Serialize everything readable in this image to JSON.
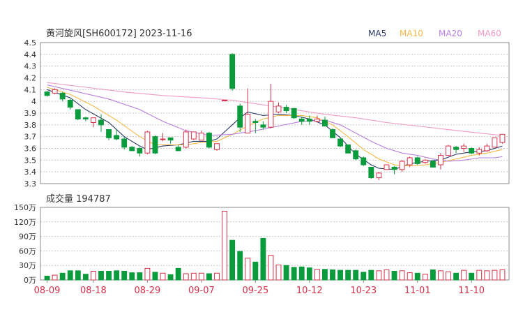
{
  "header": {
    "title": "黄河旋风[SH600172] 2023-11-16",
    "ma_legend": [
      {
        "label": "MA5",
        "color": "#2b3a67"
      },
      {
        "label": "MA10",
        "color": "#f5b94a"
      },
      {
        "label": "MA20",
        "color": "#b77fdf"
      },
      {
        "label": "MA60",
        "color": "#f09ac3"
      }
    ]
  },
  "colors": {
    "up": "#d6314a",
    "down": "#0a9b3c",
    "grid": "#c8c8c8",
    "axis": "#333333"
  },
  "chart_data": [
    {
      "type": "candlestick",
      "title": "黄河旋风[SH600172] 2023-11-16",
      "ylim": [
        3.3,
        4.5
      ],
      "yticks": [
        "3.3",
        "3.4",
        "3.5",
        "3.6",
        "3.7",
        "3.8",
        "3.9",
        "4",
        "4.1",
        "4.2",
        "4.3",
        "4.4",
        "4.5"
      ],
      "xtick_labels": [
        {
          "i": 0,
          "label": "08-09"
        },
        {
          "i": 6,
          "label": "08-18"
        },
        {
          "i": 13,
          "label": "08-29"
        },
        {
          "i": 20,
          "label": "09-07"
        },
        {
          "i": 27,
          "label": "09-25"
        },
        {
          "i": 34,
          "label": "10-12"
        },
        {
          "i": 41,
          "label": "10-23"
        },
        {
          "i": 48,
          "label": "11-01"
        },
        {
          "i": 55,
          "label": "11-10"
        }
      ],
      "candles": [
        {
          "o": 4.08,
          "c": 4.05,
          "h": 4.09,
          "l": 4.04
        },
        {
          "o": 4.07,
          "c": 4.1,
          "h": 4.11,
          "l": 4.06
        },
        {
          "o": 4.07,
          "c": 4.02,
          "h": 4.08,
          "l": 4.0
        },
        {
          "o": 4.01,
          "c": 3.95,
          "h": 4.02,
          "l": 3.93
        },
        {
          "o": 3.93,
          "c": 3.85,
          "h": 3.93,
          "l": 3.84
        },
        {
          "o": 3.86,
          "c": 3.85,
          "h": 3.87,
          "l": 3.83
        },
        {
          "o": 3.82,
          "c": 3.86,
          "h": 3.86,
          "l": 3.78
        },
        {
          "o": 3.84,
          "c": 3.8,
          "h": 3.89,
          "l": 3.74
        },
        {
          "o": 3.76,
          "c": 3.69,
          "h": 3.76,
          "l": 3.67
        },
        {
          "o": 3.71,
          "c": 3.68,
          "h": 3.76,
          "l": 3.67
        },
        {
          "o": 3.68,
          "c": 3.61,
          "h": 3.7,
          "l": 3.59
        },
        {
          "o": 3.61,
          "c": 3.58,
          "h": 3.62,
          "l": 3.58
        },
        {
          "o": 3.6,
          "c": 3.56,
          "h": 3.61,
          "l": 3.53
        },
        {
          "o": 3.56,
          "c": 3.74,
          "h": 3.75,
          "l": 3.55
        },
        {
          "o": 3.7,
          "c": 3.56,
          "h": 3.71,
          "l": 3.55
        },
        {
          "o": 3.68,
          "c": 3.68,
          "h": 3.73,
          "l": 3.66
        },
        {
          "o": 3.69,
          "c": 3.67,
          "h": 3.69,
          "l": 3.64
        },
        {
          "o": 3.61,
          "c": 3.58,
          "h": 3.63,
          "l": 3.58
        },
        {
          "o": 3.61,
          "c": 3.74,
          "h": 3.76,
          "l": 3.6
        },
        {
          "o": 3.68,
          "c": 3.74,
          "h": 3.74,
          "l": 3.67
        },
        {
          "o": 3.67,
          "c": 3.73,
          "h": 3.75,
          "l": 3.67
        },
        {
          "o": 3.73,
          "c": 3.61,
          "h": 3.74,
          "l": 3.6
        },
        {
          "o": 3.59,
          "c": 3.64,
          "h": 3.64,
          "l": 3.58
        },
        {
          "o": 4.01,
          "c": 4.01,
          "h": 4.01,
          "l": 4.01
        },
        {
          "o": 4.4,
          "c": 4.11,
          "h": 4.41,
          "l": 4.09
        },
        {
          "o": 3.96,
          "c": 3.78,
          "h": 3.98,
          "l": 3.74
        },
        {
          "o": 3.73,
          "c": 3.89,
          "h": 4.11,
          "l": 3.73
        },
        {
          "o": 3.83,
          "c": 3.82,
          "h": 3.85,
          "l": 3.73
        },
        {
          "o": 3.8,
          "c": 3.78,
          "h": 3.83,
          "l": 3.76
        },
        {
          "o": 3.78,
          "c": 4.0,
          "h": 4.15,
          "l": 3.77
        },
        {
          "o": 3.91,
          "c": 3.96,
          "h": 3.99,
          "l": 3.9
        },
        {
          "o": 3.95,
          "c": 3.92,
          "h": 3.97,
          "l": 3.9
        },
        {
          "o": 3.94,
          "c": 3.86,
          "h": 3.94,
          "l": 3.85
        },
        {
          "o": 3.85,
          "c": 3.83,
          "h": 3.87,
          "l": 3.8
        },
        {
          "o": 3.85,
          "c": 3.83,
          "h": 3.88,
          "l": 3.8
        },
        {
          "o": 3.83,
          "c": 3.85,
          "h": 3.88,
          "l": 3.82
        },
        {
          "o": 3.84,
          "c": 3.79,
          "h": 3.87,
          "l": 3.79
        },
        {
          "o": 3.76,
          "c": 3.69,
          "h": 3.77,
          "l": 3.69
        },
        {
          "o": 3.68,
          "c": 3.62,
          "h": 3.68,
          "l": 3.61
        },
        {
          "o": 3.63,
          "c": 3.56,
          "h": 3.63,
          "l": 3.56
        },
        {
          "o": 3.58,
          "c": 3.51,
          "h": 3.59,
          "l": 3.5
        },
        {
          "o": 3.52,
          "c": 3.46,
          "h": 3.53,
          "l": 3.45
        },
        {
          "o": 3.44,
          "c": 3.35,
          "h": 3.44,
          "l": 3.34
        },
        {
          "o": 3.35,
          "c": 3.39,
          "h": 3.4,
          "l": 3.33
        },
        {
          "o": 3.42,
          "c": 3.46,
          "h": 3.46,
          "l": 3.42
        },
        {
          "o": 3.44,
          "c": 3.42,
          "h": 3.45,
          "l": 3.38
        },
        {
          "o": 3.42,
          "c": 3.49,
          "h": 3.5,
          "l": 3.4
        },
        {
          "o": 3.46,
          "c": 3.52,
          "h": 3.53,
          "l": 3.44
        },
        {
          "o": 3.52,
          "c": 3.47,
          "h": 3.53,
          "l": 3.46
        },
        {
          "o": 3.48,
          "c": 3.5,
          "h": 3.51,
          "l": 3.47
        },
        {
          "o": 3.49,
          "c": 3.44,
          "h": 3.5,
          "l": 3.44
        },
        {
          "o": 3.46,
          "c": 3.54,
          "h": 3.56,
          "l": 3.42
        },
        {
          "o": 3.54,
          "c": 3.62,
          "h": 3.63,
          "l": 3.54
        },
        {
          "o": 3.61,
          "c": 3.59,
          "h": 3.62,
          "l": 3.56
        },
        {
          "o": 3.6,
          "c": 3.62,
          "h": 3.64,
          "l": 3.57
        },
        {
          "o": 3.6,
          "c": 3.56,
          "h": 3.61,
          "l": 3.55
        },
        {
          "o": 3.56,
          "c": 3.59,
          "h": 3.61,
          "l": 3.54
        },
        {
          "o": 3.58,
          "c": 3.62,
          "h": 3.64,
          "l": 3.57
        },
        {
          "o": 3.61,
          "c": 3.69,
          "h": 3.69,
          "l": 3.61
        },
        {
          "o": 3.65,
          "c": 3.72,
          "h": 3.72,
          "l": 3.64
        }
      ],
      "ma": [
        {
          "name": "MA5",
          "color": "#2b3a67",
          "values": [
            [
              0,
              4.1
            ],
            [
              3,
              4.03
            ],
            [
              5,
              3.93
            ],
            [
              8,
              3.82
            ],
            [
              10,
              3.7
            ],
            [
              12,
              3.62
            ],
            [
              13,
              3.59
            ],
            [
              15,
              3.62
            ],
            [
              17,
              3.63
            ],
            [
              19,
              3.66
            ],
            [
              21,
              3.66
            ],
            [
              22,
              3.68
            ],
            [
              24,
              3.8
            ],
            [
              25,
              3.86
            ],
            [
              26,
              3.91
            ],
            [
              28,
              3.88
            ],
            [
              30,
              3.89
            ],
            [
              32,
              3.88
            ],
            [
              34,
              3.85
            ],
            [
              36,
              3.8
            ],
            [
              38,
              3.69
            ],
            [
              40,
              3.55
            ],
            [
              42,
              3.46
            ],
            [
              43,
              3.43
            ],
            [
              45,
              3.42
            ],
            [
              47,
              3.47
            ],
            [
              49,
              3.49
            ],
            [
              51,
              3.5
            ],
            [
              53,
              3.55
            ],
            [
              55,
              3.57
            ],
            [
              57,
              3.58
            ],
            [
              59,
              3.62
            ]
          ]
        },
        {
          "name": "MA10",
          "color": "#f5b94a",
          "values": [
            [
              0,
              4.12
            ],
            [
              3,
              4.06
            ],
            [
              6,
              3.96
            ],
            [
              9,
              3.84
            ],
            [
              12,
              3.7
            ],
            [
              14,
              3.63
            ],
            [
              16,
              3.63
            ],
            [
              18,
              3.63
            ],
            [
              20,
              3.65
            ],
            [
              22,
              3.66
            ],
            [
              24,
              3.72
            ],
            [
              26,
              3.79
            ],
            [
              28,
              3.85
            ],
            [
              30,
              3.88
            ],
            [
              33,
              3.88
            ],
            [
              35,
              3.86
            ],
            [
              37,
              3.8
            ],
            [
              39,
              3.7
            ],
            [
              41,
              3.59
            ],
            [
              43,
              3.51
            ],
            [
              45,
              3.46
            ],
            [
              47,
              3.45
            ],
            [
              49,
              3.46
            ],
            [
              51,
              3.48
            ],
            [
              53,
              3.51
            ],
            [
              55,
              3.54
            ],
            [
              57,
              3.56
            ],
            [
              59,
              3.59
            ]
          ]
        },
        {
          "name": "MA20",
          "color": "#b77fdf",
          "values": [
            [
              0,
              4.14
            ],
            [
              4,
              4.08
            ],
            [
              8,
              4.02
            ],
            [
              12,
              3.93
            ],
            [
              15,
              3.83
            ],
            [
              18,
              3.75
            ],
            [
              21,
              3.71
            ],
            [
              24,
              3.72
            ],
            [
              27,
              3.75
            ],
            [
              30,
              3.79
            ],
            [
              33,
              3.83
            ],
            [
              36,
              3.84
            ],
            [
              38,
              3.8
            ],
            [
              40,
              3.73
            ],
            [
              42,
              3.66
            ],
            [
              44,
              3.6
            ],
            [
              46,
              3.56
            ],
            [
              48,
              3.54
            ],
            [
              50,
              3.51
            ],
            [
              52,
              3.49
            ],
            [
              54,
              3.5
            ],
            [
              56,
              3.52
            ],
            [
              58,
              3.52
            ],
            [
              59,
              3.53
            ]
          ]
        },
        {
          "name": "MA60",
          "color": "#f09ac3",
          "values": [
            [
              0,
              4.16
            ],
            [
              5,
              4.12
            ],
            [
              10,
              4.08
            ],
            [
              15,
              4.05
            ],
            [
              20,
              4.03
            ],
            [
              24,
              4.01
            ],
            [
              28,
              3.97
            ],
            [
              32,
              3.93
            ],
            [
              36,
              3.89
            ],
            [
              40,
              3.86
            ],
            [
              44,
              3.82
            ],
            [
              48,
              3.79
            ],
            [
              52,
              3.76
            ],
            [
              56,
              3.73
            ],
            [
              59,
              3.71
            ]
          ]
        }
      ]
    },
    {
      "type": "bar",
      "title": "成交量 194787",
      "ylim": [
        0,
        150
      ],
      "yticks": [
        "0万",
        "30万",
        "60万",
        "90万",
        "120万",
        "150万"
      ],
      "unit": "万",
      "volumes": [
        8,
        10,
        14,
        19,
        19,
        12,
        18,
        18,
        18,
        19,
        18,
        15,
        15,
        24,
        16,
        14,
        11,
        24,
        13,
        14,
        14,
        13,
        14,
        142,
        82,
        59,
        45,
        37,
        86,
        51,
        31,
        30,
        26,
        27,
        25,
        22,
        22,
        21,
        20,
        20,
        20,
        16,
        20,
        19,
        21,
        18,
        19,
        15,
        14,
        12,
        21,
        19,
        17,
        14,
        20,
        14,
        20,
        19,
        20,
        21
      ]
    }
  ]
}
